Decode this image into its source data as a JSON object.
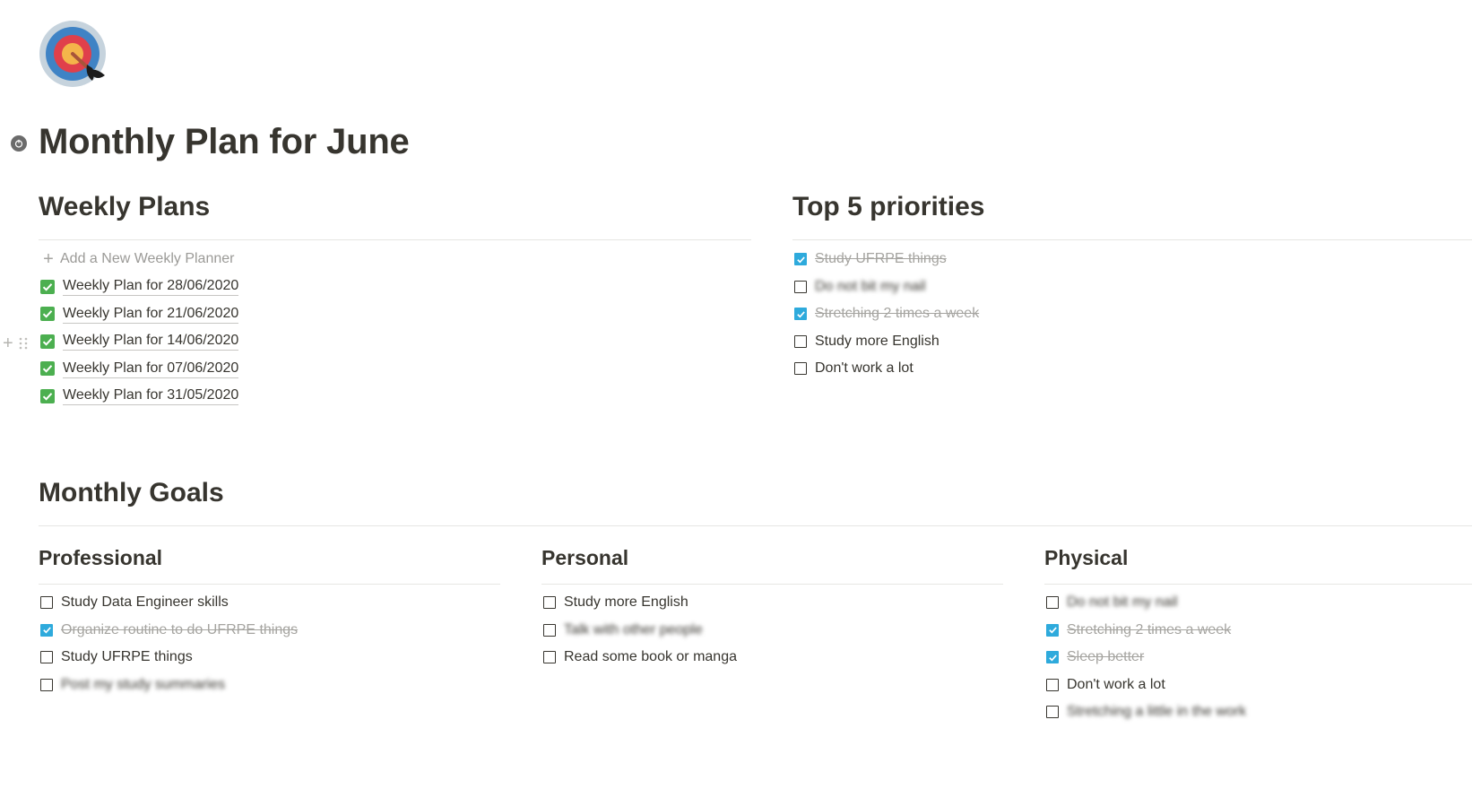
{
  "page": {
    "title": "Monthly Plan for June",
    "icon": "target-dart-icon"
  },
  "weekly": {
    "heading": "Weekly Plans",
    "add_label": "Add a New Weekly Planner",
    "items": [
      {
        "label": "Weekly Plan for 28/06/2020"
      },
      {
        "label": "Weekly Plan for 21/06/2020"
      },
      {
        "label": "Weekly Plan for 14/06/2020"
      },
      {
        "label": "Weekly Plan for 07/06/2020"
      },
      {
        "label": "Weekly Plan for 31/05/2020"
      }
    ]
  },
  "priorities": {
    "heading": "Top 5 priorities",
    "items": [
      {
        "label": "Study UFRPE things",
        "checked": true
      },
      {
        "label": "Do not bit my nail",
        "checked": false
      },
      {
        "label": "Stretching 2 times a week",
        "checked": true
      },
      {
        "label": "Study more English",
        "checked": false
      },
      {
        "label": "Don't work a lot",
        "checked": false
      }
    ]
  },
  "goals": {
    "heading": "Monthly Goals",
    "professional": {
      "heading": "Professional",
      "items": [
        {
          "label": "Study Data Engineer skills",
          "checked": false
        },
        {
          "label": "Organize routine to do UFRPE things",
          "checked": true
        },
        {
          "label": "Study UFRPE things",
          "checked": false
        },
        {
          "label": "Post my study summaries",
          "checked": false
        }
      ]
    },
    "personal": {
      "heading": "Personal",
      "items": [
        {
          "label": "Study more English",
          "checked": false
        },
        {
          "label": "Talk with other people",
          "checked": false
        },
        {
          "label": "Read some book or manga",
          "checked": false
        }
      ]
    },
    "physical": {
      "heading": "Physical",
      "items": [
        {
          "label": "Do not bit my nail",
          "checked": false
        },
        {
          "label": "Stretching 2 times a week",
          "checked": true
        },
        {
          "label": "Sleep better",
          "checked": true
        },
        {
          "label": "Don't work a lot",
          "checked": false
        },
        {
          "label": "Stretching a little in the work",
          "checked": false
        }
      ]
    }
  },
  "colors": {
    "text": "#37352f",
    "checkbox_blue": "#2eaadc",
    "page_check_green": "#4caf50",
    "muted": "#a5a4a0"
  }
}
